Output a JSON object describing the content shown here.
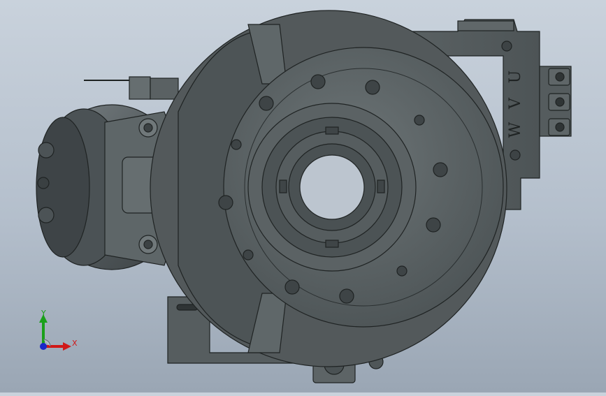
{
  "viewport": {
    "background_top": "#c9d2dc",
    "background_bottom": "#9aa6b4",
    "model": {
      "engraved_text": [
        "U",
        "V",
        "W"
      ],
      "body_color": "#5b6264",
      "edge_color": "#1f2323"
    }
  },
  "triad": {
    "y_label": "Y",
    "x_label": "X",
    "y_color": "#1aa01a",
    "x_color": "#d01818",
    "origin_color": "#1a28c8"
  }
}
